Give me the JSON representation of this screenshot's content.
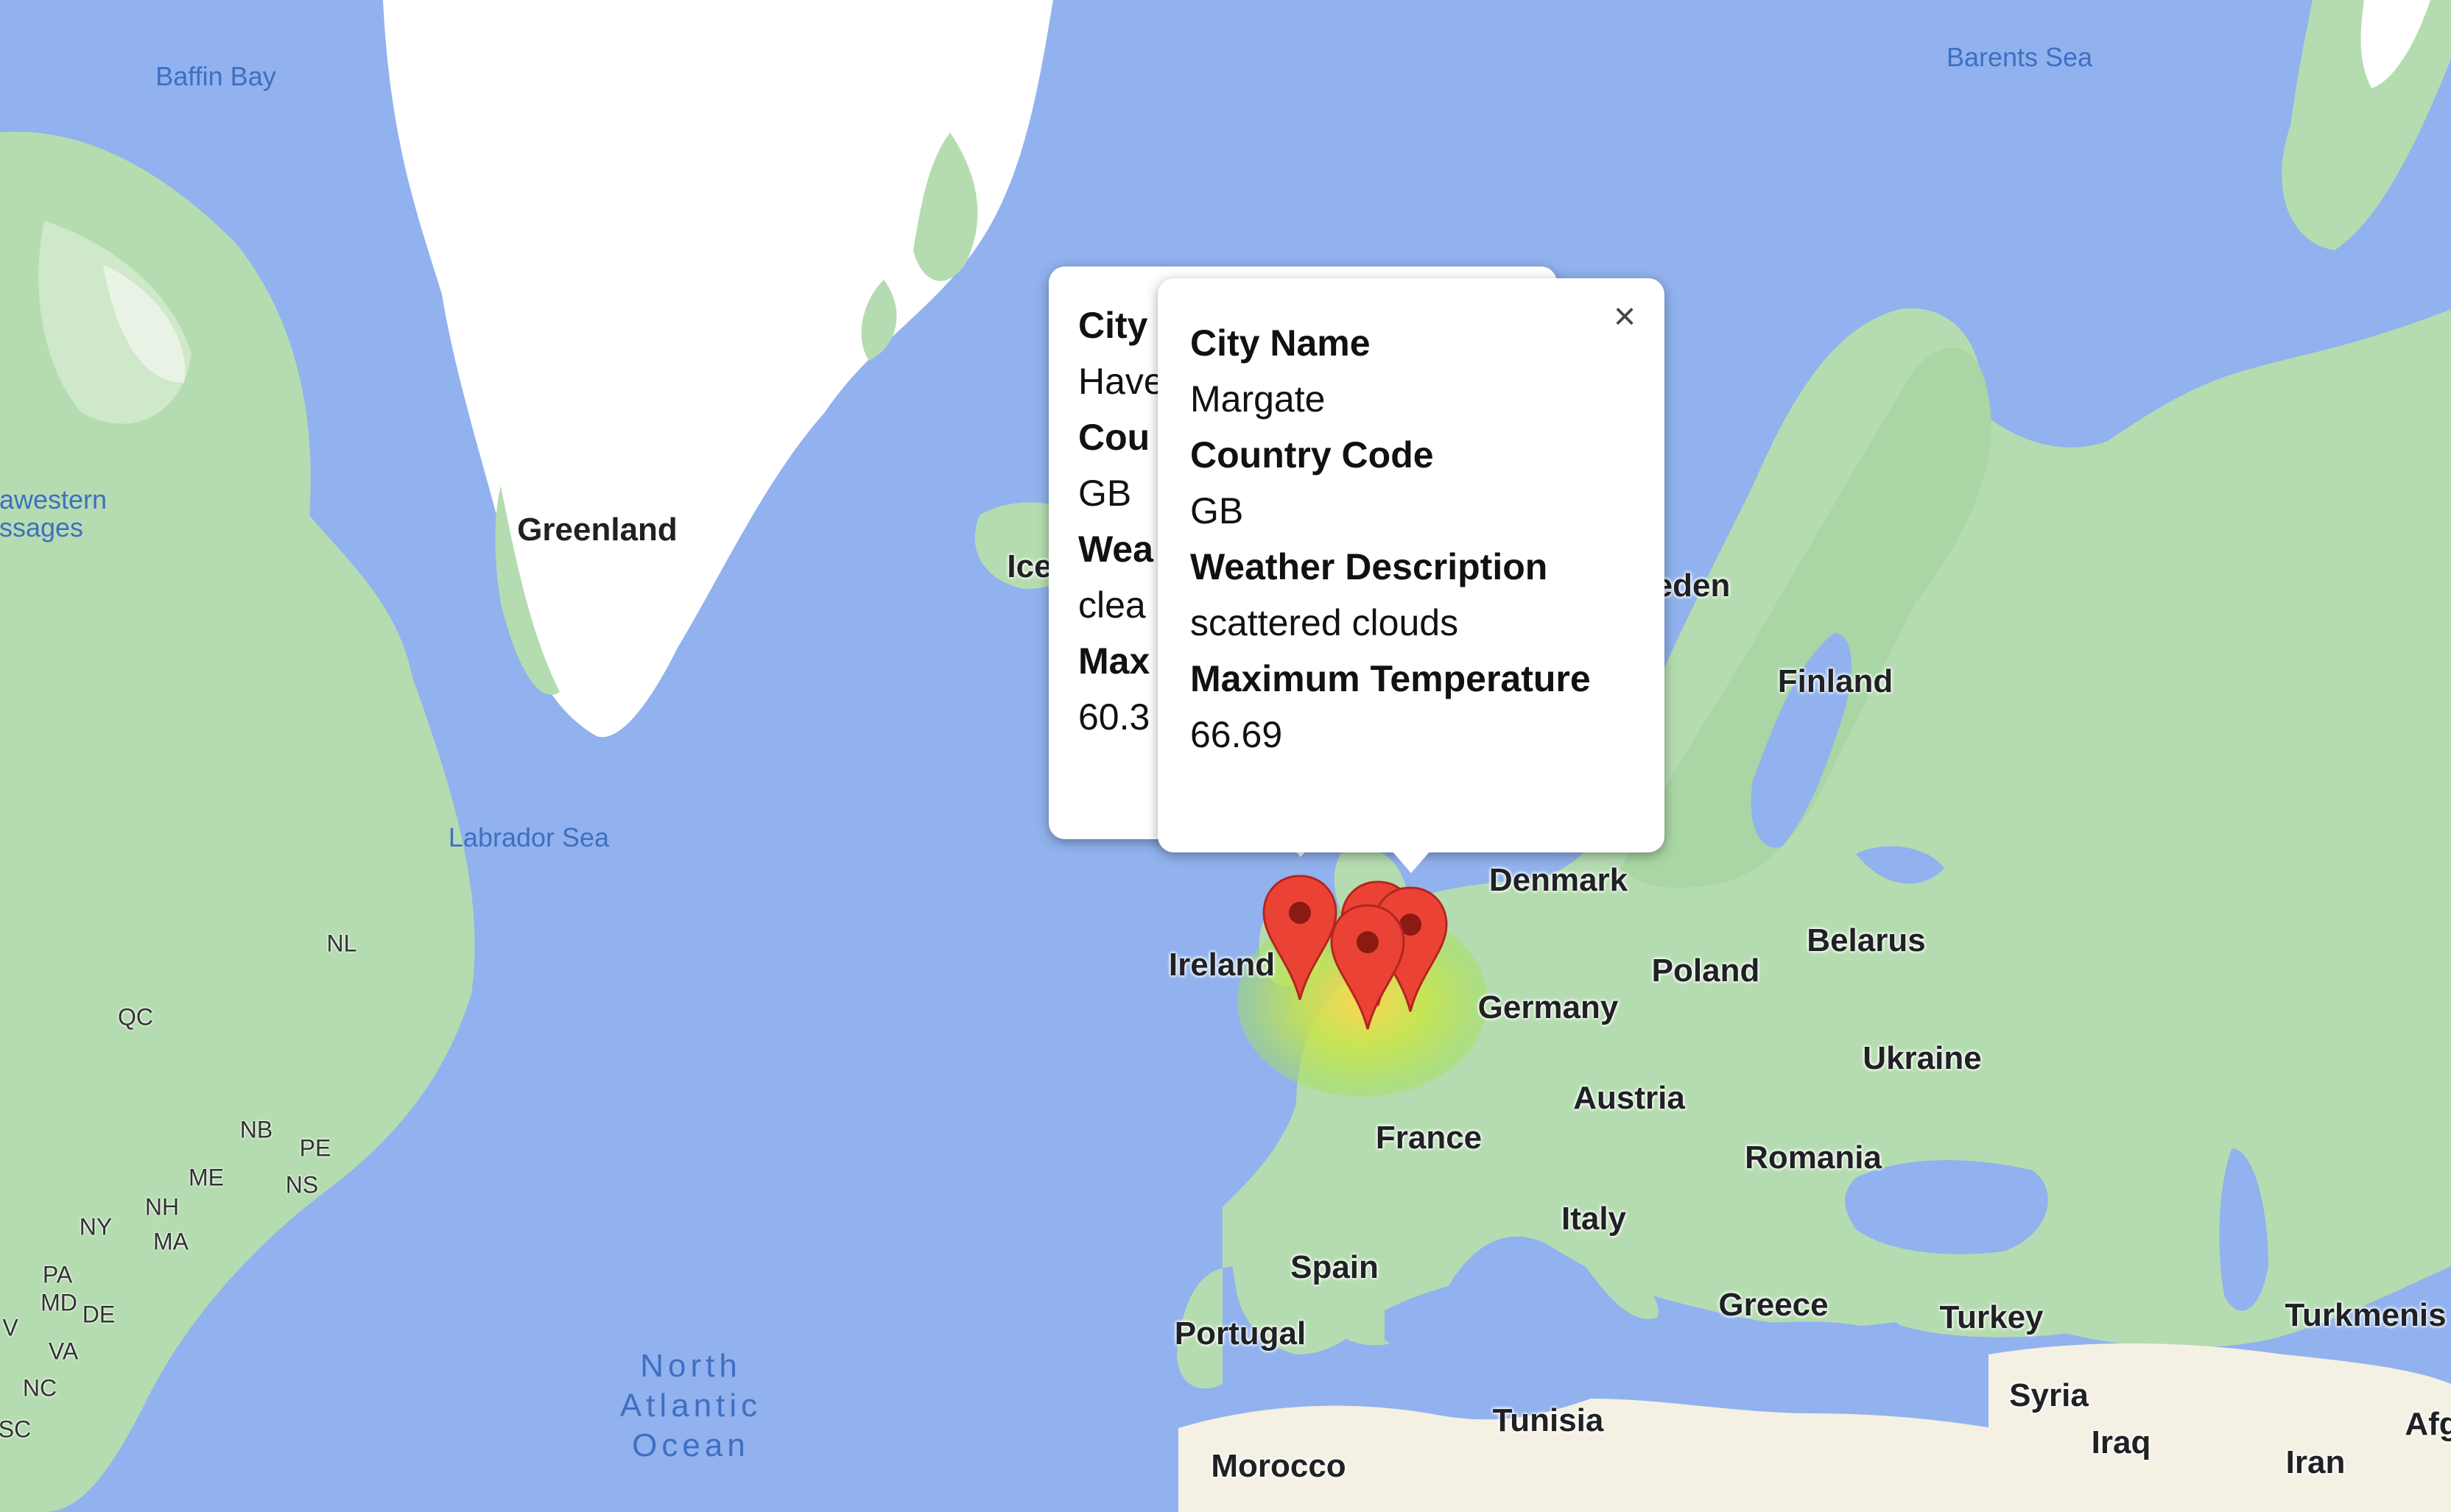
{
  "map": {
    "water_labels": [
      "Baffin Bay",
      "Barents Sea",
      "Labrador Sea",
      "awestern",
      "ssages"
    ],
    "ocean_label": [
      "North",
      "Atlantic",
      "Ocean"
    ],
    "country_labels": [
      "Greenland",
      "Ice",
      "Ireland",
      "Denmark",
      "eden",
      "Finland",
      "Poland",
      "Belarus",
      "Germany",
      "Ukraine",
      "Austria",
      "France",
      "Romania",
      "Italy",
      "Spain",
      "Portugal",
      "Greece",
      "Turkey",
      "Turkmenis",
      "Syria",
      "Iraq",
      "Iran",
      "Afg",
      "Tunisia",
      "Morocco"
    ],
    "state_labels": [
      "QC",
      "NL",
      "NB",
      "PE",
      "NS",
      "ME",
      "NH",
      "NY",
      "MA",
      "PA",
      "MD",
      "DE",
      "VA",
      "NC",
      "SC",
      "V"
    ]
  },
  "popup_back": {
    "fields": [
      {
        "key": "City",
        "value": "Have"
      },
      {
        "key": "Cou",
        "value": "GB"
      },
      {
        "key": "Wea",
        "value": "clea"
      },
      {
        "key": "Max",
        "value": "60.3"
      }
    ]
  },
  "popup_front": {
    "close_glyph": "×",
    "fields": [
      {
        "key": "City Name",
        "value": "Margate"
      },
      {
        "key": "Country Code",
        "value": "GB"
      },
      {
        "key": "Weather Description",
        "value": "scattered clouds"
      },
      {
        "key": "Maximum Temperature",
        "value": "66.69"
      }
    ]
  },
  "markers": [
    {
      "name": "map-marker-1",
      "color": "#ea4335"
    },
    {
      "name": "map-marker-2",
      "color": "#ea4335"
    },
    {
      "name": "map-marker-3",
      "color": "#ea4335"
    },
    {
      "name": "map-marker-4",
      "color": "#ea4335"
    }
  ],
  "colors": {
    "water": "#91b2ee",
    "land": "#b5dcb0",
    "desert": "#f5f0e4",
    "ice": "#ffffff",
    "heat_center": "#ffd54f",
    "heat_edge": "#a5e05c"
  }
}
